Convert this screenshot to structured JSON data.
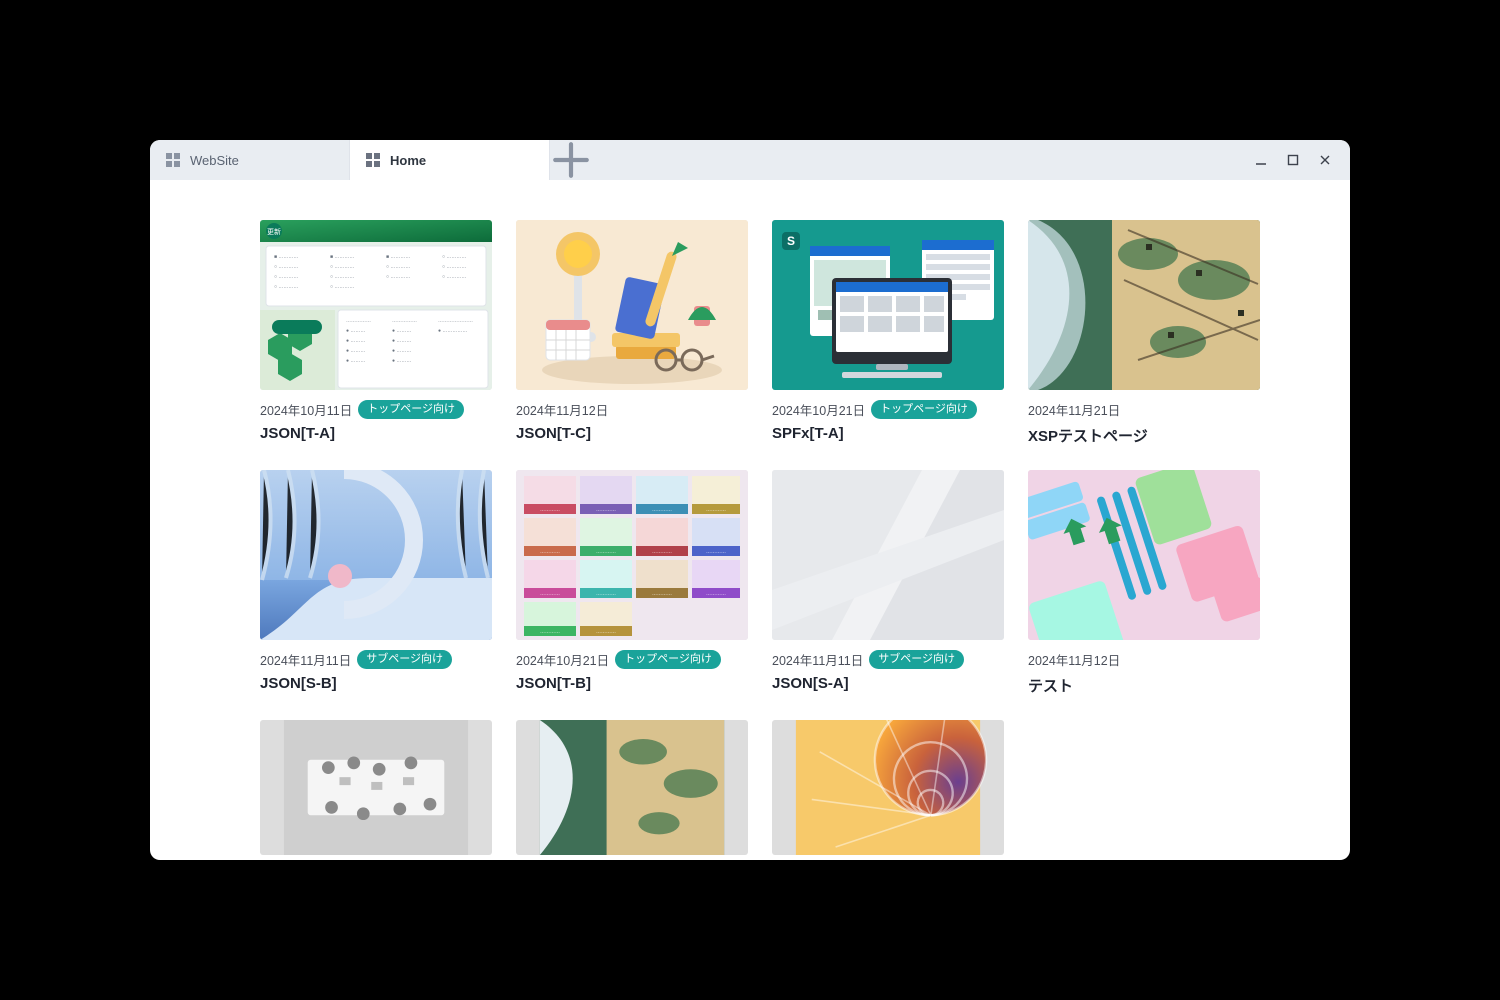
{
  "tabs": [
    {
      "label": "WebSite",
      "active": false
    },
    {
      "label": "Home",
      "active": true
    }
  ],
  "cards": [
    {
      "date": "2024年10月11日",
      "tag": "トップページ向け",
      "title": "JSON[T-A]"
    },
    {
      "date": "2024年11月12日",
      "tag": null,
      "title": "JSON[T-C]"
    },
    {
      "date": "2024年10月21日",
      "tag": "トップページ向け",
      "title": "SPFx[T-A]"
    },
    {
      "date": "2024年11月21日",
      "tag": null,
      "title": "XSPテストページ"
    },
    {
      "date": "2024年11月11日",
      "tag": "サブページ向け",
      "title": "JSON[S-B]"
    },
    {
      "date": "2024年10月21日",
      "tag": "トップページ向け",
      "title": "JSON[T-B]"
    },
    {
      "date": "2024年11月11日",
      "tag": "サブページ向け",
      "title": "JSON[S-A]"
    },
    {
      "date": "2024年11月12日",
      "tag": null,
      "title": "テスト"
    }
  ]
}
